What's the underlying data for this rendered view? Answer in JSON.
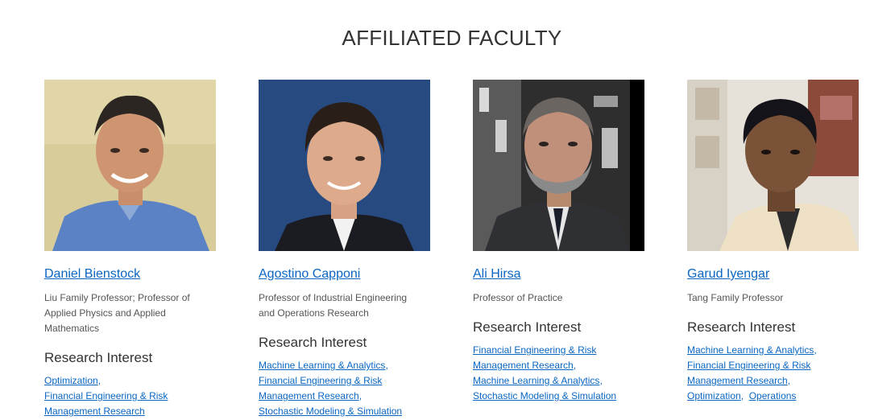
{
  "page_title": "AFFILIATED FACULTY",
  "faculty": [
    {
      "name": "Daniel Bienstock",
      "title": "Liu Family Professor; Professor of Applied Physics and Applied Mathematics",
      "research_heading": "Research Interest",
      "interests": [
        "Optimization",
        "Financial Engineering & Risk Management Research"
      ]
    },
    {
      "name": "Agostino Capponi",
      "title": "Professor of Industrial Engineering and Operations Research",
      "research_heading": "Research Interest",
      "interests": [
        "Machine Learning & Analytics",
        "Financial Engineering & Risk Management Research",
        "Stochastic Modeling & Simulation"
      ]
    },
    {
      "name": "Ali Hirsa",
      "title": "Professor of Practice",
      "research_heading": "Research Interest",
      "interests": [
        "Financial Engineering & Risk Management Research",
        "Machine Learning & Analytics",
        "Stochastic Modeling & Simulation"
      ]
    },
    {
      "name": "Garud Iyengar",
      "title": "Tang Family Professor",
      "research_heading": "Research Interest",
      "interests": [
        "Machine Learning & Analytics",
        "Financial Engineering & Risk Management Research",
        "Optimization",
        "Operations"
      ]
    }
  ],
  "colors": {
    "link": "#0a66c2",
    "text": "#333333",
    "muted": "#555555"
  }
}
